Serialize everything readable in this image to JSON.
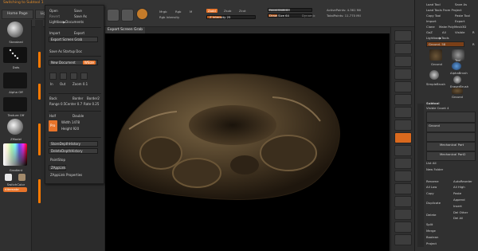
{
  "app": {
    "title_text": "Switching to Subtool 1"
  },
  "top_tabs": [
    {
      "label": "Home Page"
    },
    {
      "label": "LightBo"
    }
  ],
  "toolbar": {
    "mrgb": "Mrgb",
    "rgb": "Rgb",
    "m": "M",
    "zadd": "Zadd",
    "zsub": "Zsub",
    "zcut": "Zcut",
    "rgb_intensity": "Rgb Intensity",
    "z_intensity_label": "Z Intensity",
    "z_intensity_value": "25",
    "focal_shift_label": "Focal Shift",
    "focal_shift_value": "0",
    "draw_size_label": "Draw Size",
    "draw_size_value": "64",
    "dynamic": "Dynamic",
    "active_points": "ActivePoints: 4.361 Mil",
    "total_points": "TotalPoints: 11.770 Mil"
  },
  "left_shelf": {
    "standard": "Standard",
    "dots": "Dots",
    "alpha_off": "Alpha Off",
    "texture_off": "Texture Off",
    "zmodel": "ZModel",
    "gradient": "Gradient",
    "switch_color": "SwitchColor",
    "alternate": "Alternate"
  },
  "menu": {
    "open": "Open",
    "save": "Save",
    "revert": "Revert",
    "save_as": "Save As",
    "lightbox_documents": "Lightbox▶Documents",
    "import": "Import",
    "export": "Export",
    "export_screen_grab": "Export Screen Grab",
    "save_as_startup_doc": "Save As Startup Doc",
    "new_document": "New Document",
    "wsize": "WSize",
    "in": "In",
    "out": "Out",
    "zoom_label": "Zoom",
    "zoom_value": "0.1",
    "back": "Back",
    "border": "Border",
    "border2": "Border2",
    "range_label": "Range",
    "range_value": "0.5",
    "center_label": "Center",
    "center_value": "0.7",
    "rate_label": "Rate",
    "rate_value": "0.25",
    "half": "Half",
    "double": "Double",
    "pro": "Pro",
    "width_label": "Width",
    "width_value": "1478",
    "height_label": "Height",
    "height_value": "920",
    "store_depth_history": "StoreDepthHistory",
    "delete_depth_history": "DeleteDepthHistory",
    "paint_stop": "PaintStop",
    "zapplink": "ZAppLink",
    "zapplink_properties": "ZAppLink Properties"
  },
  "canvas": {
    "export_tooltip": "Export Screen Grab",
    "background": "#000000",
    "model_color": "#4a3b26"
  },
  "right_panel": {
    "load_tool": "Load Tool",
    "save_as": "Save As",
    "load_tools_from_project": "Load Tools From Project",
    "copy_tool": "Copy Tool",
    "paste_tool": "Paste Tool",
    "import": "Import",
    "export": "Export",
    "clone": "Clone",
    "make_polymesh3d": "Make PolyMesh3D",
    "goz": "GoZ",
    "all": "All",
    "visible": "Visible",
    "r": "R",
    "lightbox_tools": "Lightbox▶Tools",
    "ground_slider": "Ground. 58",
    "r2": "R",
    "tools": [
      {
        "label": "Ground"
      },
      {
        "label": "Tool"
      },
      {
        "label": "AlphaBrush"
      },
      {
        "label": "SimpleBrush"
      },
      {
        "label": "EraserBrush"
      },
      {
        "label": "Ground"
      }
    ],
    "subtool": "Subtool",
    "visible_count": "Visible Count 4",
    "sub_ground": "Ground",
    "mechanical_part": "Mechanical Part",
    "mechanical_part2": "Mechanical Part2",
    "list_all": "List All",
    "new_folder": "New Folder",
    "rename": "Rename",
    "auto_reorder": "AutoReorder",
    "all_low": "All Low",
    "all_high": "All High",
    "copy": "Copy",
    "paste": "Paste",
    "duplicate": "Duplicate",
    "append": "Append",
    "insert": "Insert",
    "delete": "Delete",
    "del_other": "Del Other",
    "del_all": "Del All",
    "split": "Split",
    "merge": "Merge",
    "boolean": "Boolean",
    "project": "Project"
  },
  "colors": {
    "accent_orange": "#e8742a",
    "panel": "#303030",
    "canvas": "#000000"
  }
}
